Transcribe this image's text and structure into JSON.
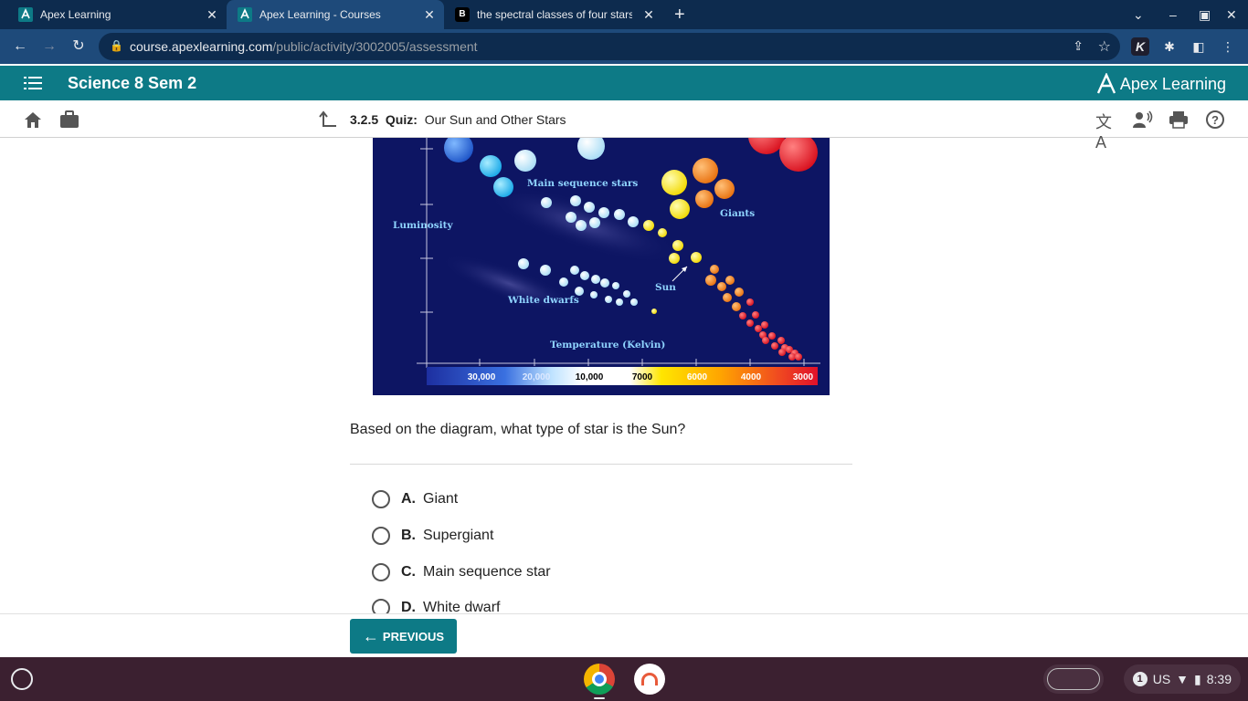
{
  "browser": {
    "tabs": [
      {
        "title": "Apex Learning"
      },
      {
        "title": "Apex Learning - Courses"
      },
      {
        "title": "the spectral classes of four stars"
      }
    ],
    "url_host": "course.apexlearning.com",
    "url_path": "/public/activity/3002005/assessment"
  },
  "apex": {
    "course_title": "Science 8 Sem 2",
    "logo_text": "Apex Learning"
  },
  "quiz": {
    "number": "3.2.5",
    "type": "Quiz:",
    "title": "Our Sun and Other Stars"
  },
  "diagram": {
    "labels": {
      "main_sequence": "Main sequence stars",
      "giants": "Giants",
      "luminosity": "Luminosity",
      "white_dwarfs": "White dwarfs",
      "sun": "Sun",
      "temperature": "Temperature (Kelvin)"
    },
    "temperature_ticks": [
      "30,000",
      "20,000",
      "10,000",
      "7000",
      "6000",
      "4000",
      "3000"
    ]
  },
  "question": {
    "text": "Based on the diagram, what type of star is the Sun?",
    "choices": [
      {
        "letter": "A.",
        "text": "Giant"
      },
      {
        "letter": "B.",
        "text": "Supergiant"
      },
      {
        "letter": "C.",
        "text": "Main sequence star"
      },
      {
        "letter": "D.",
        "text": "White dwarf"
      }
    ]
  },
  "footer": {
    "previous_label": "PREVIOUS"
  },
  "shelf": {
    "notification_count": "1",
    "keyboard": "US",
    "time": "8:39"
  }
}
